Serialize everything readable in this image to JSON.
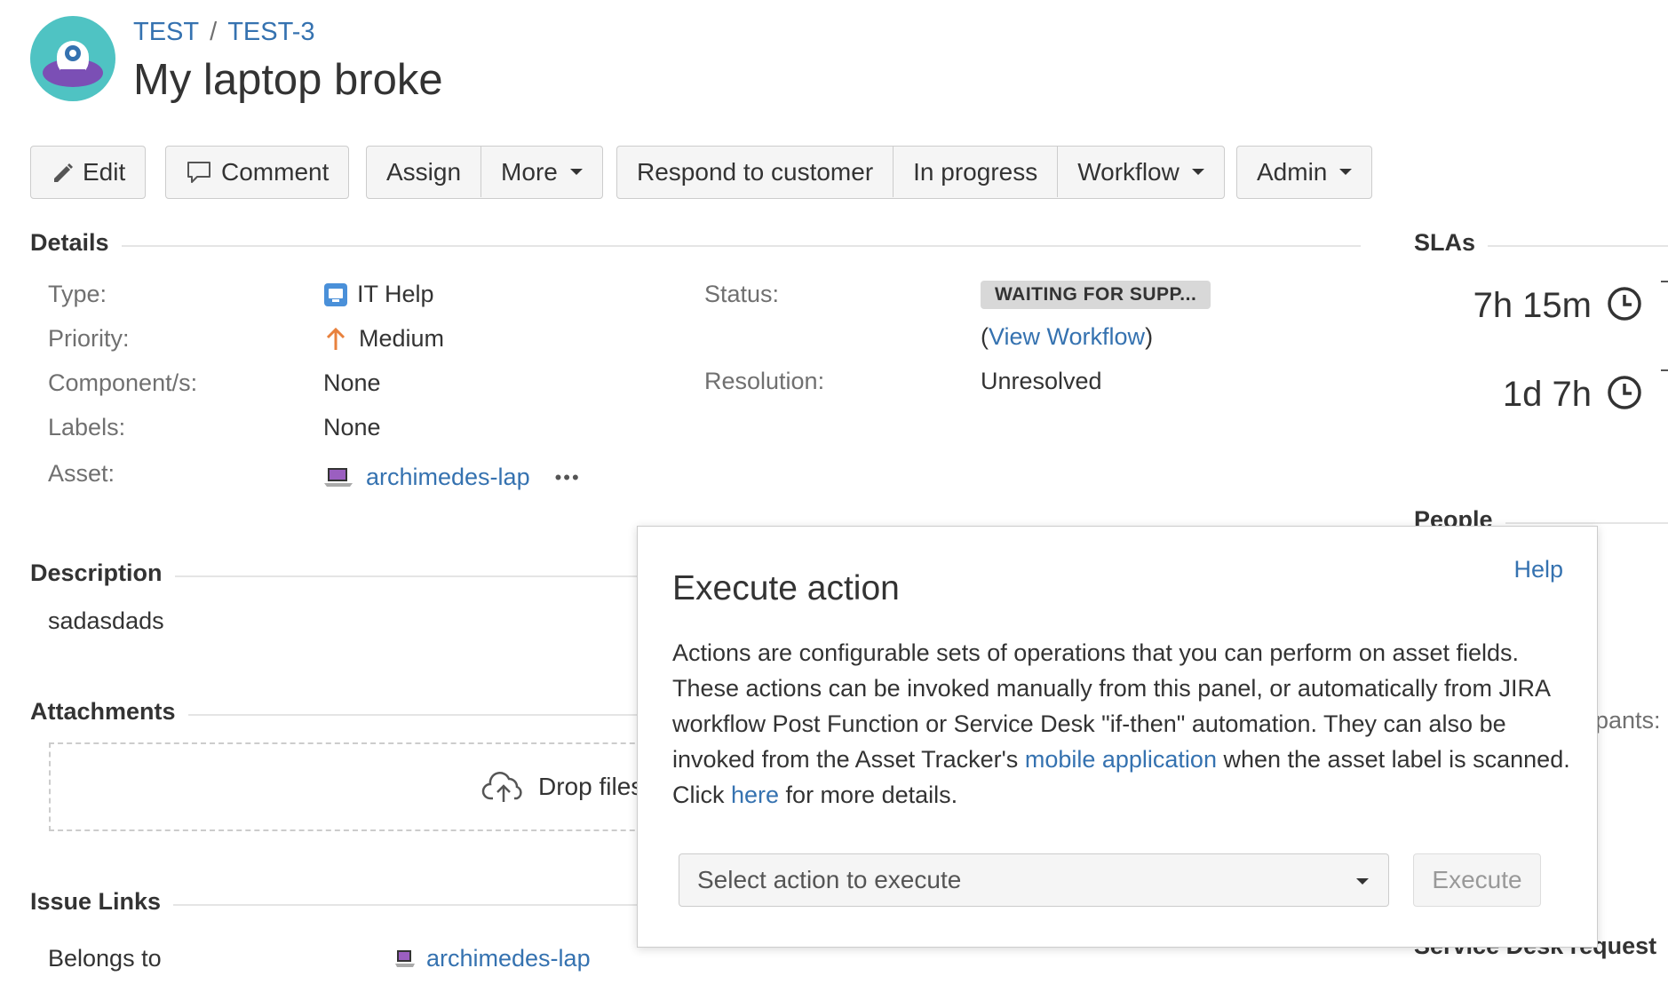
{
  "breadcrumb": {
    "project": "TEST",
    "separator": "/",
    "issue_key": "TEST-3"
  },
  "issue": {
    "title": "My laptop broke"
  },
  "toolbar": {
    "edit": "Edit",
    "comment": "Comment",
    "assign": "Assign",
    "more": "More",
    "respond": "Respond to customer",
    "in_progress": "In progress",
    "workflow": "Workflow",
    "admin": "Admin"
  },
  "details": {
    "heading": "Details",
    "type": {
      "label": "Type:",
      "value": "IT Help"
    },
    "priority": {
      "label": "Priority:",
      "value": "Medium"
    },
    "components": {
      "label": "Component/s:",
      "value": "None"
    },
    "labels": {
      "label": "Labels:",
      "value": "None"
    },
    "asset": {
      "label": "Asset:",
      "value": "archimedes-lap",
      "more": "•••"
    },
    "status": {
      "label": "Status:",
      "value": "WAITING FOR SUPP...",
      "view_workflow_open": "(",
      "view_workflow": "View Workflow",
      "view_workflow_close": ")"
    },
    "resolution": {
      "label": "Resolution:",
      "value": "Unresolved"
    }
  },
  "slas": {
    "heading": "SLAs",
    "items": [
      {
        "time": "7h 15m"
      },
      {
        "time": "1d 7h"
      }
    ]
  },
  "people": {
    "heading": "People",
    "participants_fragment": "pants:"
  },
  "service_desk": {
    "heading_fragment": "Service Desk request"
  },
  "description": {
    "heading": "Description",
    "text": "sadasdads"
  },
  "attachments": {
    "heading": "Attachments",
    "drop_label": "Drop files"
  },
  "issue_links": {
    "heading": "Issue Links",
    "relation": "Belongs to",
    "target": "archimedes-lap"
  },
  "dialog": {
    "title": "Execute action",
    "help": "Help",
    "body_1": "Actions are configurable sets of operations that you can perform on asset fields. These actions can be invoked manually from this panel, or automatically from JIRA workflow Post Function or Service Desk \"if-then\" automation. They can also be invoked from the Asset Tracker's ",
    "link_mobile": "mobile application",
    "body_2": " when the asset label is scanned. Click ",
    "link_here": "here",
    "body_3": " for more details.",
    "select_placeholder": "Select action to execute",
    "execute": "Execute"
  },
  "colors": {
    "link": "#3572b0",
    "priority_medium": "#e8813d",
    "type_icon": "#4a90d9",
    "avatar_bg": "#4fc3c3",
    "avatar_body": "#7b4fb5"
  }
}
